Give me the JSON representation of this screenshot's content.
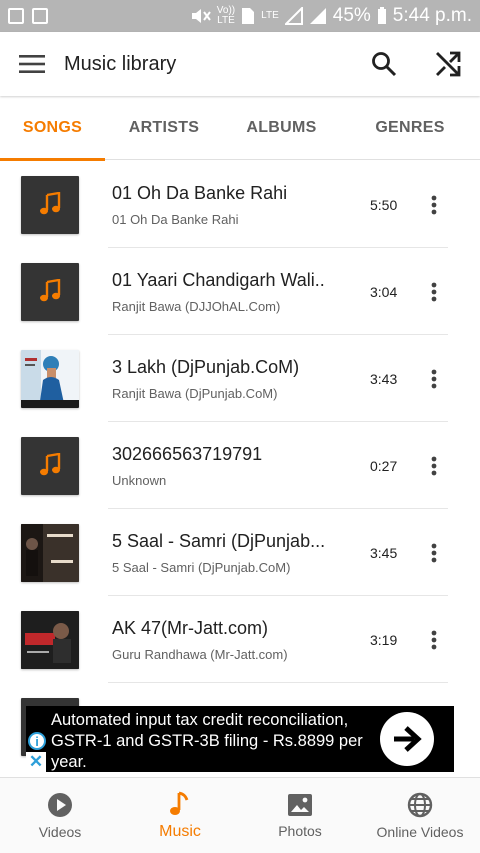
{
  "status_bar": {
    "battery": "45%",
    "time": "5:44 p.m.",
    "lte_label": "LTE",
    "volte_label": "Vo))",
    "sim_label": "1"
  },
  "toolbar": {
    "title": "Music library",
    "menu_icon": "hamburger-menu-icon",
    "search_icon": "search-icon",
    "shuffle_icon": "shuffle-icon"
  },
  "tabs": [
    {
      "label": "SONGS",
      "active": true
    },
    {
      "label": "ARTISTS",
      "active": false
    },
    {
      "label": "ALBUMS",
      "active": false
    },
    {
      "label": "GENRES",
      "active": false
    }
  ],
  "songs": [
    {
      "title": "01 Oh Da Banke Rahi",
      "subtitle": "01 Oh Da Banke Rahi",
      "duration": "5:50",
      "art": "music-note-placeholder"
    },
    {
      "title": "01 Yaari Chandigarh Wali..",
      "subtitle": "Ranjit Bawa (DJJOhAL.Com)",
      "duration": "3:04",
      "art": "music-note-placeholder"
    },
    {
      "title": "3 Lakh (DjPunjab.CoM)",
      "subtitle": "Ranjit Bawa (DjPunjab.CoM)",
      "duration": "3:43",
      "art": "album-cover-3-lakh",
      "art_caption": "3 Lakh"
    },
    {
      "title": "302666563719791",
      "subtitle": "Unknown",
      "duration": "0:27",
      "art": "music-note-placeholder"
    },
    {
      "title": "5 Saal - Samri (DjPunjab...",
      "subtitle": "5 Saal - Samri (DjPunjab.CoM)",
      "duration": "3:45",
      "art": "album-cover-5-saal",
      "art_caption": "5 Saal Samri"
    },
    {
      "title": "AK 47(Mr-Jatt.com)",
      "subtitle": "Guru Randhawa (Mr-Jatt.com)",
      "duration": "3:19",
      "art": "album-cover-ak47",
      "art_caption": "AK47"
    }
  ],
  "ad": {
    "text": "Automated input tax credit reconciliation, GSTR-1 and GSTR-3B filing - Rs.8899 per year.",
    "info_icon": "info-icon",
    "close_icon": "close-icon",
    "go_icon": "arrow-right-icon"
  },
  "bottom_nav": [
    {
      "label": "Videos",
      "icon": "play-circle-icon",
      "active": false
    },
    {
      "label": "Music",
      "icon": "music-note-icon",
      "active": true
    },
    {
      "label": "Photos",
      "icon": "image-icon",
      "active": false
    },
    {
      "label": "Online Videos",
      "icon": "globe-icon",
      "active": false
    }
  ],
  "colors": {
    "accent": "#f57c00",
    "status_bar": "#b5b5b5",
    "placeholder_art": "#343434"
  }
}
